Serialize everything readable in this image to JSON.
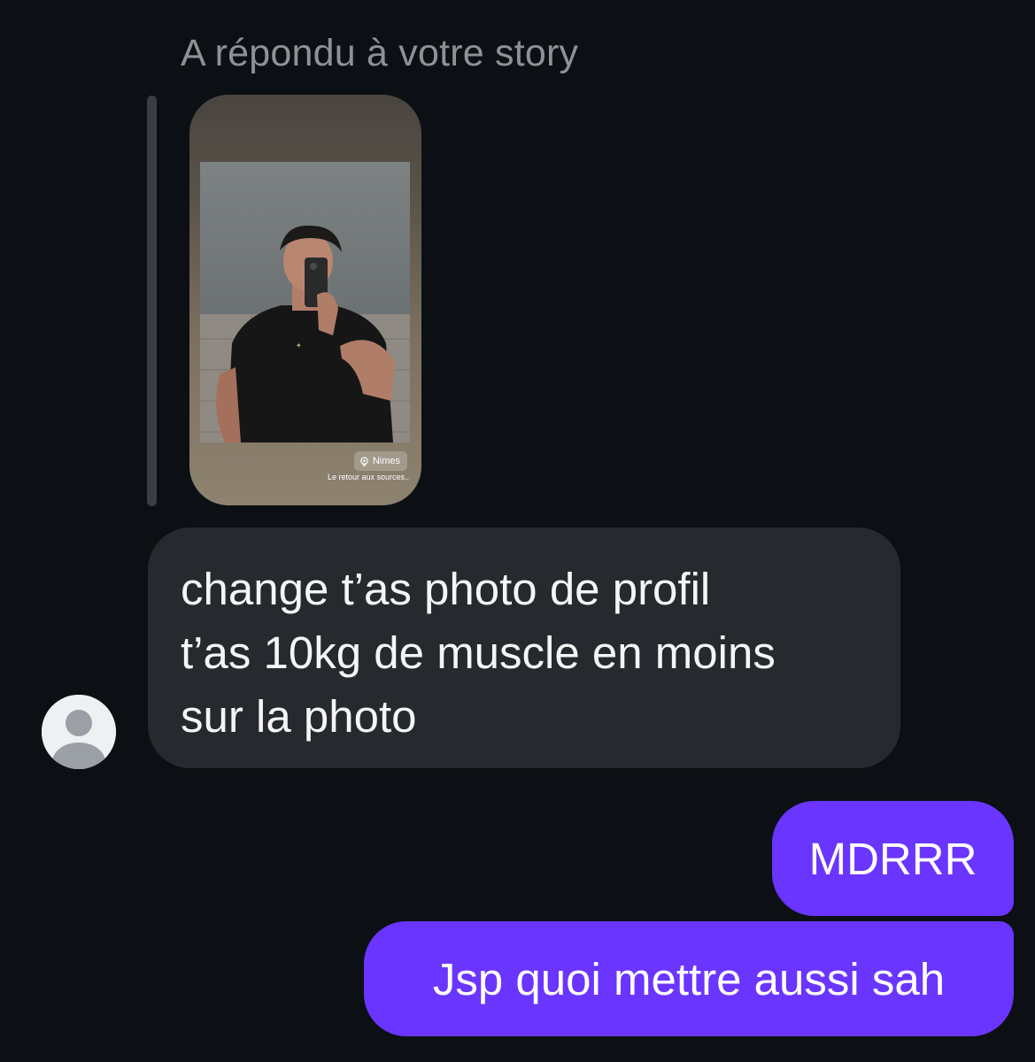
{
  "story_reply": {
    "caption": "A répondu à votre story",
    "location": "Nimes",
    "story_text": "Le retour aux sources..",
    "location_icon": "map-pin-icon"
  },
  "messages": {
    "incoming": {
      "lines": [
        "change t’as photo de profil",
        "t’as 10kg de muscle en moins",
        "sur la photo"
      ],
      "avatar_icon": "default-user-avatar-icon",
      "bubble_color": "#262a2f"
    },
    "outgoing": [
      {
        "text": "MDRRR"
      },
      {
        "text": "Jsp quoi mettre aussi sah"
      }
    ],
    "outgoing_color": "#6a35ff"
  },
  "colors": {
    "background": "#0c1014",
    "caption": "#8e9297"
  }
}
